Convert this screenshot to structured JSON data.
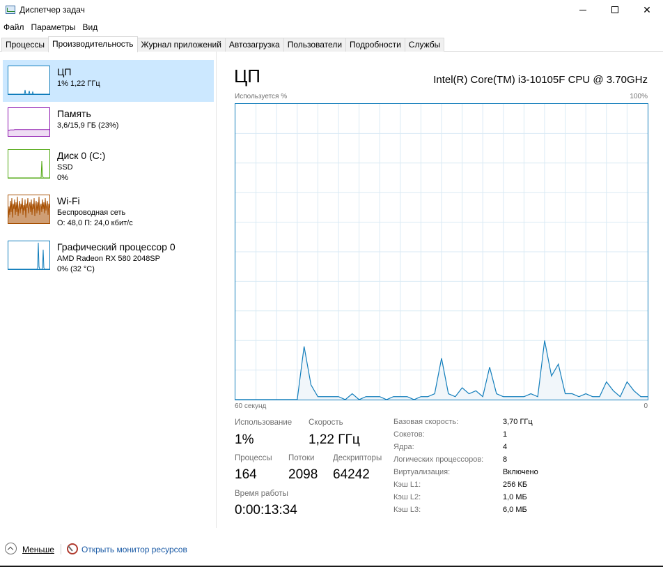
{
  "window": {
    "title": "Диспетчер задач",
    "minimize_icon": "minimize-icon",
    "maximize_icon": "maximize-icon",
    "close_icon": "close-icon"
  },
  "menu": [
    "Файл",
    "Параметры",
    "Вид"
  ],
  "tabs": [
    {
      "label": "Процессы",
      "active": false
    },
    {
      "label": "Производительность",
      "active": true
    },
    {
      "label": "Журнал приложений",
      "active": false
    },
    {
      "label": "Автозагрузка",
      "active": false
    },
    {
      "label": "Пользователи",
      "active": false
    },
    {
      "label": "Подробности",
      "active": false
    },
    {
      "label": "Службы",
      "active": false
    }
  ],
  "resources": [
    {
      "name": "ЦП",
      "sub1": "1% 1,22 ГГц",
      "sub2": "",
      "color": "#117dbb",
      "fill": "#f1f6fa",
      "selected": true,
      "graph": [
        0,
        0,
        0,
        0,
        0,
        0,
        0,
        0,
        0,
        0,
        0,
        0,
        0,
        0,
        0,
        0,
        0,
        0,
        0,
        0,
        0,
        0,
        0,
        0,
        15,
        0,
        0,
        0,
        0,
        0,
        12,
        0,
        0,
        0,
        0,
        8,
        0,
        0,
        0,
        0,
        0,
        0,
        0,
        0,
        0,
        0,
        0,
        0,
        0,
        0,
        0,
        0,
        0,
        0,
        0,
        0,
        0,
        0,
        0,
        0
      ]
    },
    {
      "name": "Память",
      "sub1": "3,6/15,9 ГБ (23%)",
      "sub2": "",
      "color": "#8b12ae",
      "fill": "#f4f2f4",
      "selected": false,
      "graph": [
        20,
        20,
        21,
        22,
        22,
        22,
        22,
        22,
        22,
        23,
        23,
        23,
        23,
        23,
        23,
        23,
        23,
        23,
        23,
        23,
        23,
        23,
        23,
        23,
        23,
        23,
        23,
        23,
        23,
        23,
        23,
        23,
        23,
        23,
        23,
        23,
        23,
        23,
        23,
        23,
        23,
        23,
        23,
        23,
        23,
        23,
        23,
        23,
        23,
        23,
        23,
        23,
        23,
        23,
        23,
        23,
        23,
        23,
        23,
        23
      ]
    },
    {
      "name": "Диск 0 (C:)",
      "sub1": "SSD",
      "sub2": "0%",
      "color": "#4da60c",
      "fill": "#eff4ec",
      "selected": false,
      "graph": [
        0,
        0,
        0,
        0,
        0,
        0,
        0,
        0,
        0,
        0,
        0,
        0,
        0,
        0,
        0,
        0,
        0,
        0,
        0,
        0,
        0,
        0,
        0,
        0,
        0,
        0,
        0,
        0,
        0,
        0,
        0,
        0,
        0,
        0,
        0,
        0,
        0,
        0,
        0,
        0,
        0,
        0,
        0,
        0,
        0,
        0,
        0,
        0,
        60,
        10,
        0,
        0,
        0,
        0,
        0,
        0,
        0,
        0,
        0,
        0
      ]
    },
    {
      "name": "Wi-Fi",
      "sub1": "Беспроводная сеть",
      "sub2": "О: 48,0 П: 24,0 кбит/с",
      "color": "#a74f01",
      "fill": "#fcf3eb",
      "selected": false,
      "graph": [
        20,
        60,
        30,
        80,
        40,
        90,
        20,
        70,
        50,
        85,
        30,
        75,
        40,
        95,
        25,
        60,
        80,
        35,
        70,
        50,
        90,
        30,
        65,
        45,
        85,
        20,
        70,
        55,
        90,
        35,
        60,
        75,
        40,
        85,
        30,
        70,
        50,
        90,
        25,
        65,
        80,
        35,
        75,
        45,
        95,
        30,
        60,
        70,
        40,
        85,
        50,
        75,
        35,
        90,
        45,
        65,
        80,
        30,
        70,
        55
      ]
    },
    {
      "name": "Графический процессор 0",
      "sub1": "AMD Radeon RX 580 2048SP",
      "sub2": "0% (32 °C)",
      "color": "#117dbb",
      "fill": "#f1f6fa",
      "selected": false,
      "graph": [
        0,
        0,
        0,
        0,
        0,
        0,
        0,
        0,
        0,
        0,
        0,
        0,
        0,
        0,
        0,
        0,
        0,
        0,
        0,
        0,
        0,
        0,
        0,
        0,
        0,
        0,
        0,
        0,
        0,
        0,
        0,
        0,
        0,
        0,
        0,
        0,
        0,
        0,
        0,
        0,
        0,
        0,
        5,
        95,
        10,
        0,
        0,
        0,
        0,
        0,
        70,
        5,
        0,
        0,
        0,
        0,
        0,
        0,
        0,
        0
      ]
    }
  ],
  "main": {
    "title": "ЦП",
    "cpu_model": "Intel(R) Core(TM) i3-10105F CPU @ 3.70GHz",
    "usage_label": "Используется %",
    "max_label": "100%",
    "time_label": "60 секунд",
    "min_label": "0"
  },
  "chart_data": {
    "type": "area",
    "title": "",
    "xlabel": "60 секунд",
    "ylabel": "Используется %",
    "ylim": [
      0,
      100
    ],
    "color": "#117dbb",
    "x": [
      60,
      59,
      58,
      57,
      56,
      55,
      54,
      53,
      52,
      51,
      50,
      49,
      48,
      47,
      46,
      45,
      44,
      43,
      42,
      41,
      40,
      39,
      38,
      37,
      36,
      35,
      34,
      33,
      32,
      31,
      30,
      29,
      28,
      27,
      26,
      25,
      24,
      23,
      22,
      21,
      20,
      19,
      18,
      17,
      16,
      15,
      14,
      13,
      12,
      11,
      10,
      9,
      8,
      7,
      6,
      5,
      4,
      3,
      2,
      1,
      0
    ],
    "values": [
      0,
      0,
      0,
      0,
      0,
      0,
      0,
      0,
      0,
      0,
      18,
      5,
      1,
      1,
      1,
      1,
      0,
      2,
      0,
      1,
      1,
      1,
      0,
      1,
      1,
      1,
      0,
      1,
      1,
      2,
      14,
      2,
      1,
      4,
      2,
      3,
      1,
      11,
      2,
      1,
      1,
      1,
      1,
      2,
      1,
      20,
      8,
      12,
      2,
      2,
      1,
      2,
      1,
      1,
      6,
      3,
      1,
      6,
      3,
      1,
      1
    ]
  },
  "stats": {
    "usage_label": "Использование",
    "usage_value": "1%",
    "speed_label": "Скорость",
    "speed_value": "1,22 ГГц",
    "processes_label": "Процессы",
    "processes_value": "164",
    "threads_label": "Потоки",
    "threads_value": "2098",
    "handles_label": "Дескрипторы",
    "handles_value": "64242",
    "uptime_label": "Время работы",
    "uptime_value": "0:00:13:34"
  },
  "info": [
    {
      "key": "Базовая скорость:",
      "value": "3,70 ГГц"
    },
    {
      "key": "Сокетов:",
      "value": "1"
    },
    {
      "key": "Ядра:",
      "value": "4"
    },
    {
      "key": "Логических процессоров:",
      "value": "8"
    },
    {
      "key": "Виртуализация:",
      "value": "Включено"
    },
    {
      "key": "Кэш L1:",
      "value": "256 КБ"
    },
    {
      "key": "Кэш L2:",
      "value": "1,0 МБ"
    },
    {
      "key": "Кэш L3:",
      "value": "6,0 МБ"
    }
  ],
  "footer": {
    "fewer_label": "Меньше",
    "monitor_label": "Открыть монитор ресурсов"
  }
}
